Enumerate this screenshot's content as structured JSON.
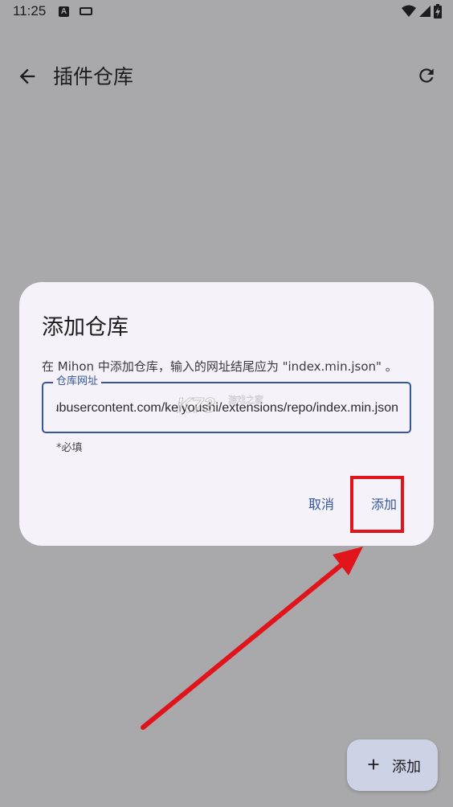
{
  "status_bar": {
    "time": "11:25",
    "a_icon_glyph": "A",
    "icons": [
      "a-icon",
      "keyboard-icon",
      "wifi-icon",
      "signal-icon",
      "battery-icon"
    ]
  },
  "app_bar": {
    "title": "插件仓库",
    "back_icon": "arrow-back-icon",
    "refresh_icon": "refresh-icon"
  },
  "dialog": {
    "title": "添加仓库",
    "message": "在 Mihon 中添加仓库，输入的网址结尾应为 \"index.min.json\" 。",
    "field_label": "仓库网址",
    "field_value": "https://raw.githubusercontent.com/keiyoushi/extensions/repo/index.min.json",
    "helper_text": "*必填",
    "cancel_label": "取消",
    "confirm_label": "添加"
  },
  "watermark": {
    "logo_text": "K73",
    "caption": "游戏之家"
  },
  "fab": {
    "label": "添加",
    "icon": "plus-icon"
  },
  "annotation": {
    "highlight_color": "#e0141a",
    "arrow_color": "#e0141a"
  },
  "colors": {
    "scrim_background": "#a9a8ab",
    "dialog_background": "#f6f2fa",
    "accent": "#34569c",
    "fab_background": "#cdd2e4"
  }
}
